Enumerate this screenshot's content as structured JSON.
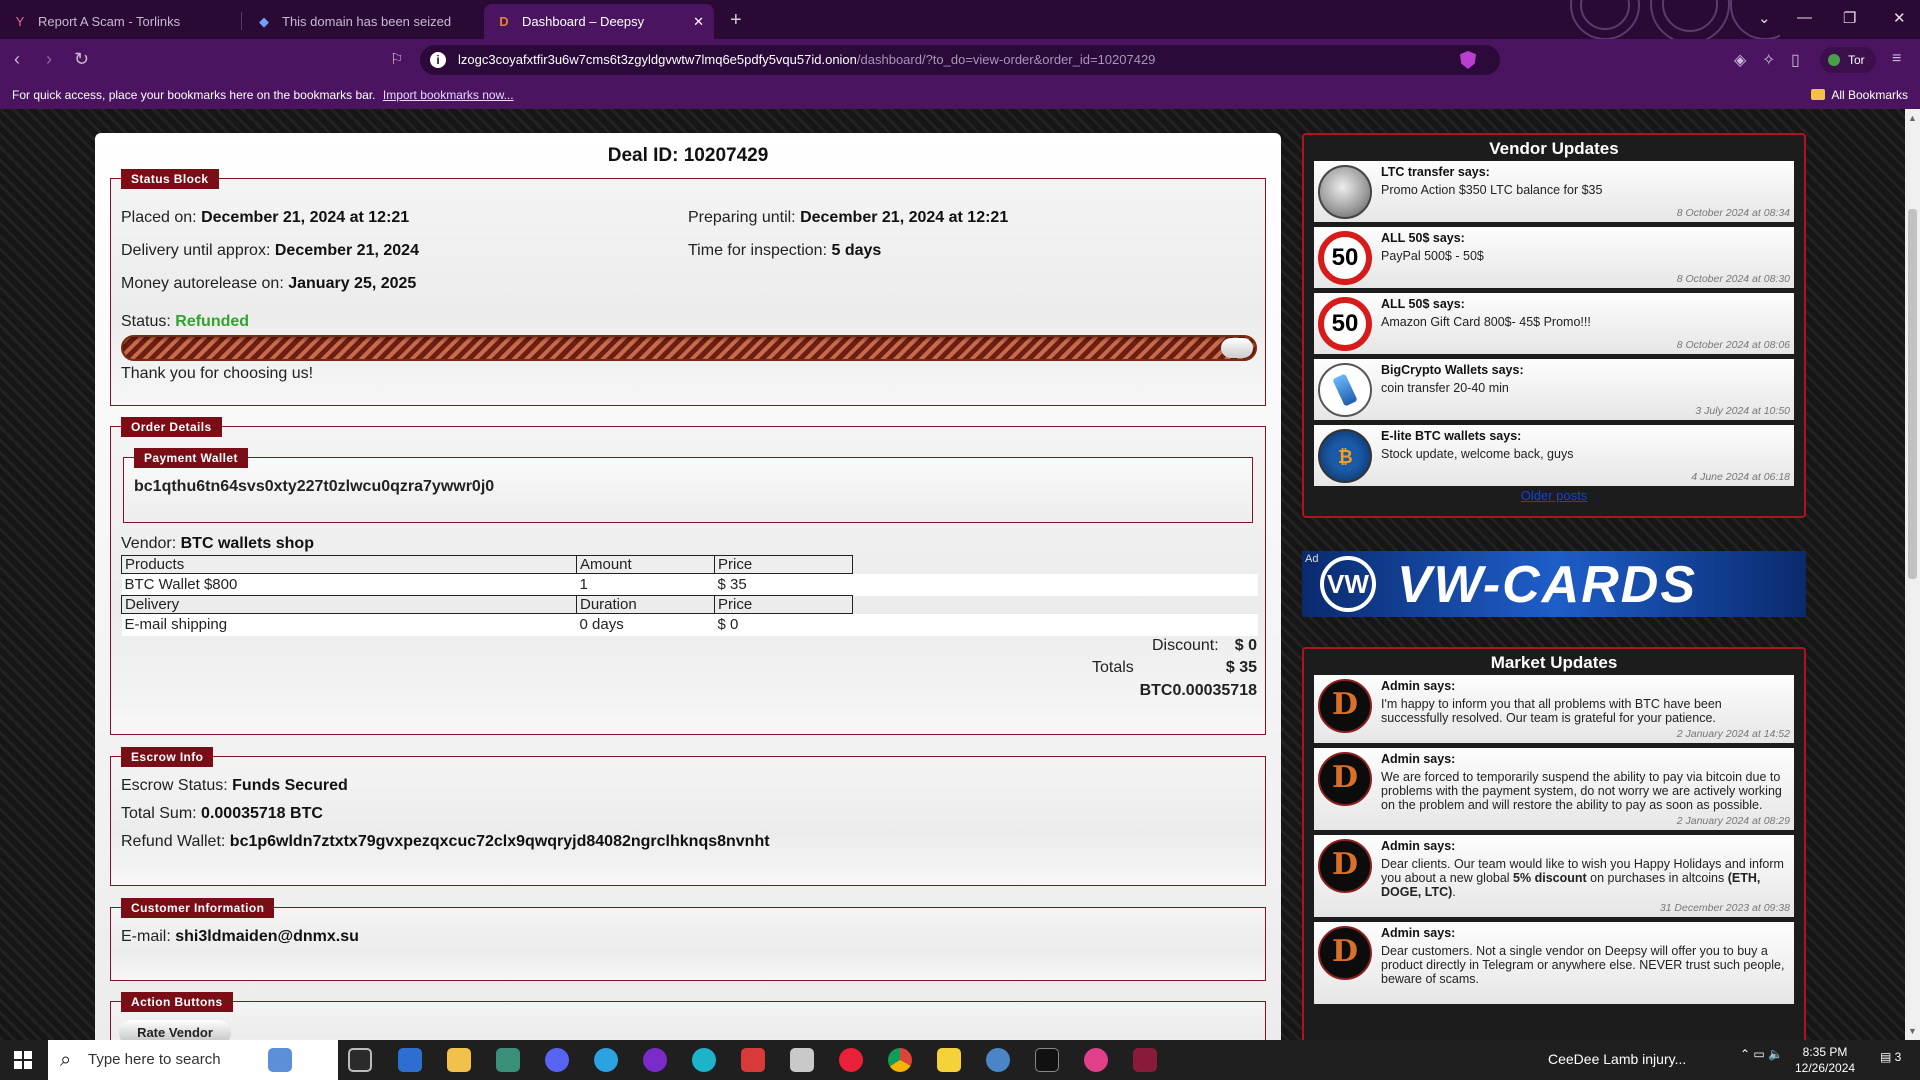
{
  "browser": {
    "tabs": [
      {
        "title": "Report A Scam - Torlinks",
        "active": false
      },
      {
        "title": "This domain has been seized",
        "active": false
      },
      {
        "title": "Dashboard – Deepsy",
        "active": true
      }
    ],
    "url_host": "lzogc3coyafxtfir3u6w7cms6t3zgyldgvwtw7lmq6e5pdfy5vqu57id.onion",
    "url_path": "/dashboard/?to_do=view-order&order_id=10207429",
    "tor_label": "Tor",
    "bookmarks_prompt": "For quick access, place your bookmarks here on the bookmarks bar.",
    "bookmarks_link": "Import bookmarks now...",
    "all_bookmarks": "All Bookmarks",
    "accent": "#4a1460"
  },
  "order": {
    "deal_title": "Deal ID: 10207429",
    "status_block": {
      "legend": "Status Block",
      "placed_label": "Placed on:",
      "placed_value": "December 21, 2024 at 12:21",
      "preparing_label": "Preparing until:",
      "preparing_value": "December 21, 2024 at 12:21",
      "delivery_label": "Delivery until approx:",
      "delivery_value": "December 21, 2024",
      "inspection_label": "Time for inspection:",
      "inspection_value": "5 days",
      "autorelease_label": "Money autorelease on:",
      "autorelease_value": "January 25, 2025",
      "status_label": "Status:",
      "status_value": "Refunded",
      "status_color": "#2fa52f",
      "progress_fraction": 1.0,
      "thanks": "Thank you for choosing us!"
    },
    "order_details": {
      "legend": "Order Details",
      "wallet_legend": "Payment Wallet",
      "wallet": "bc1qthu6tn64svs0xty227t0zlwcu0qzra7ywwr0j0",
      "vendor_label": "Vendor:",
      "vendor_value": "BTC wallets shop",
      "products_headers": [
        "Products",
        "Amount",
        "Price"
      ],
      "product_row": [
        "BTC Wallet $800",
        "1",
        "$ 35"
      ],
      "delivery_headers": [
        "Delivery",
        "Duration",
        "Price"
      ],
      "delivery_row": [
        "E-mail shipping",
        "0 days",
        "$ 0"
      ],
      "discount_label": "Discount:",
      "discount_value": "$ 0",
      "totals_label": "Totals",
      "totals_value": "$ 35",
      "totals_btc": "BTC0.00035718"
    },
    "escrow": {
      "legend": "Escrow Info",
      "status_label": "Escrow Status:",
      "status_value": "Funds Secured",
      "sum_label": "Total Sum:",
      "sum_value": "0.00035718 BTC",
      "refund_label": "Refund Wallet:",
      "refund_value": "bc1p6wldn7ztxtx79gvxpezqxcuc72clx9qwqryjd84082ngrclhknqs8nvnht"
    },
    "customer": {
      "legend": "Customer Information",
      "email_label": "E-mail:",
      "email_value": "shi3ldmaiden@dnmx.su"
    },
    "actions": {
      "legend": "Action Buttons",
      "rate_vendor": "Rate Vendor"
    }
  },
  "vendor_updates": {
    "title": "Vendor Updates",
    "items": [
      {
        "who": "LTC transfer says:",
        "text": "Promo Action $350 LTC balance for $35",
        "when": "8 October 2024 at 08:34",
        "avatar": "coin-avatar"
      },
      {
        "who": "ALL 50$ says:",
        "text": "PayPal 500$ - 50$",
        "when": "8 October 2024 at 08:30",
        "avatar": "50"
      },
      {
        "who": "ALL 50$ says:",
        "text": "Amazon Gift Card 800$- 45$ Promo!!!",
        "when": "8 October 2024 at 08:06",
        "avatar": "50"
      },
      {
        "who": "BigCrypto Wallets says:",
        "text": "coin transfer 20-40 min",
        "when": "3 July 2024 at 10:50",
        "avatar": "phone-avatar"
      },
      {
        "who": "E-lite BTC wallets says:",
        "text": "Stock update, welcome back, guys",
        "when": "4 June 2024 at 06:18",
        "avatar": "btc-avatar"
      }
    ],
    "older_posts": "Older posts"
  },
  "ad": {
    "label": "Ad",
    "logo": "VW",
    "text": "VW-CARDS"
  },
  "market_updates": {
    "title": "Market Updates",
    "items": [
      {
        "who": "Admin says:",
        "text": "I'm happy to inform you that all problems with BTC have been successfully resolved. Our team is grateful for your patience.",
        "when": "2 January 2024 at 14:52"
      },
      {
        "who": "Admin says:",
        "text": "We are forced to temporarily suspend the ability to pay via bitcoin due to problems with the payment system, do not worry we are actively working on the problem and will restore the ability to pay as soon as possible.",
        "when": "2 January 2024 at 08:29"
      },
      {
        "who": "Admin says:",
        "text_before": "Dear clients. Our team would like to wish you Happy Holidays and inform you about a new global ",
        "text_bold": "5% discount",
        "text_after": " on purchases in altcoins ",
        "text_bold2": "(ETH, DOGE, LTC)",
        "text_end": ".",
        "when": "31 December 2023 at 09:38"
      },
      {
        "who": "Admin says:",
        "text": "Dear customers. Not a single vendor on Deepsy will offer you to buy a product directly in Telegram or anywhere else. NEVER trust such people, beware of scams.",
        "when": ""
      }
    ],
    "admin_avatar_letter": "D"
  },
  "taskbar": {
    "search_placeholder": "Type here to search",
    "news": "CeeDee Lamb injury...",
    "time": "8:35 PM",
    "date": "12/26/2024",
    "notification_count": "3"
  }
}
